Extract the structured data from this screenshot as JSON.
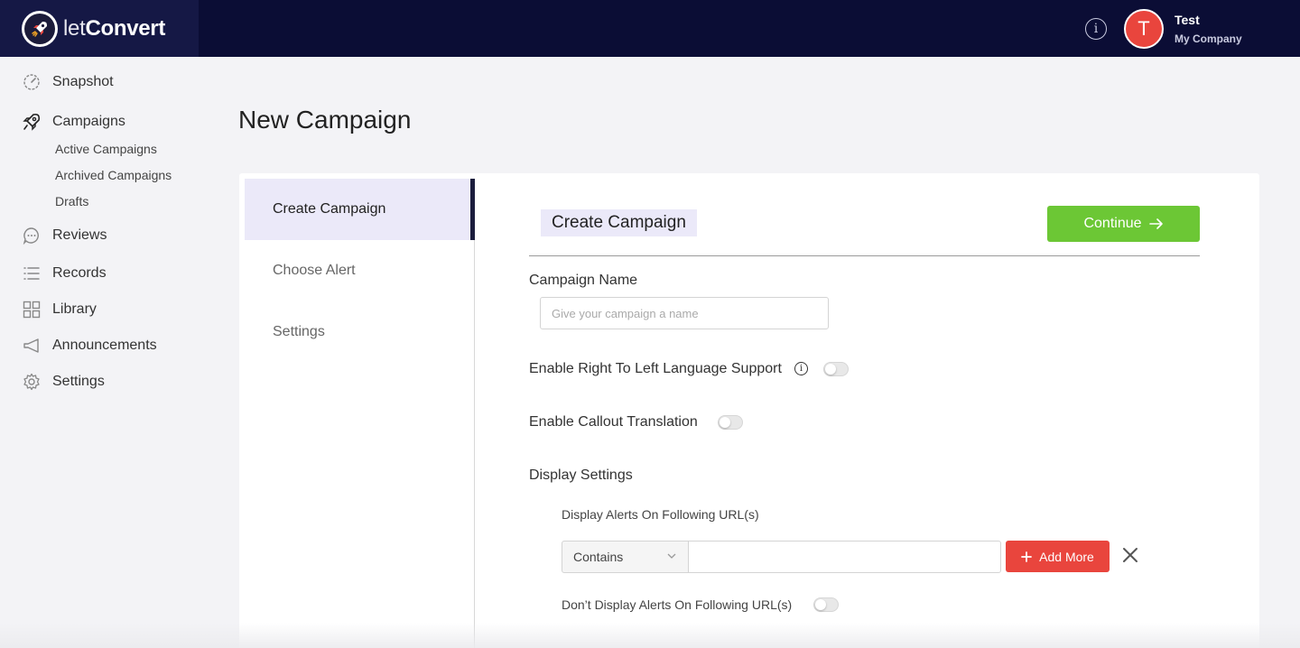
{
  "brand": {
    "name_light": "let",
    "name_bold": "Convert"
  },
  "header": {
    "info_icon": "info-icon",
    "user": {
      "initial": "T",
      "name": "Test",
      "company": "My Company",
      "avatar_color": "#e9453d"
    }
  },
  "sidebar": {
    "items": [
      {
        "label": "Snapshot",
        "icon": "speedometer-icon"
      },
      {
        "label": "Campaigns",
        "icon": "rocket-icon"
      },
      {
        "label": "Reviews",
        "icon": "chat-bubble-icon"
      },
      {
        "label": "Records",
        "icon": "list-icon"
      },
      {
        "label": "Library",
        "icon": "grid-icon"
      },
      {
        "label": "Announcements",
        "icon": "megaphone-icon"
      },
      {
        "label": "Settings",
        "icon": "gear-icon"
      }
    ],
    "campaign_subitems": [
      "Active Campaigns",
      "Archived Campaigns",
      "Drafts"
    ]
  },
  "page": {
    "title": "New Campaign"
  },
  "steps": [
    {
      "label": "Create Campaign",
      "active": true
    },
    {
      "label": "Choose Alert",
      "active": false
    },
    {
      "label": "Settings",
      "active": false
    }
  ],
  "form": {
    "section_title": "Create Campaign",
    "continue_label": "Continue",
    "campaign_name_label": "Campaign Name",
    "campaign_name_placeholder": "Give your campaign a name",
    "campaign_name_value": "",
    "rtl_label": "Enable Right To Left Language Support",
    "rtl_enabled": false,
    "callout_label": "Enable Callout Translation",
    "callout_enabled": false,
    "display_settings_label": "Display Settings",
    "display_urls_label": "Display Alerts On Following URL(s)",
    "match_type": "Contains",
    "url_value": "",
    "add_more_label": "Add More",
    "dont_display_label": "Don’t Display Alerts On Following URL(s)",
    "dont_display_enabled": false
  },
  "colors": {
    "topbar": "#0b0d35",
    "accent_green": "#6cc735",
    "accent_red": "#e9453d",
    "active_step_bg": "#ebe9f9"
  }
}
